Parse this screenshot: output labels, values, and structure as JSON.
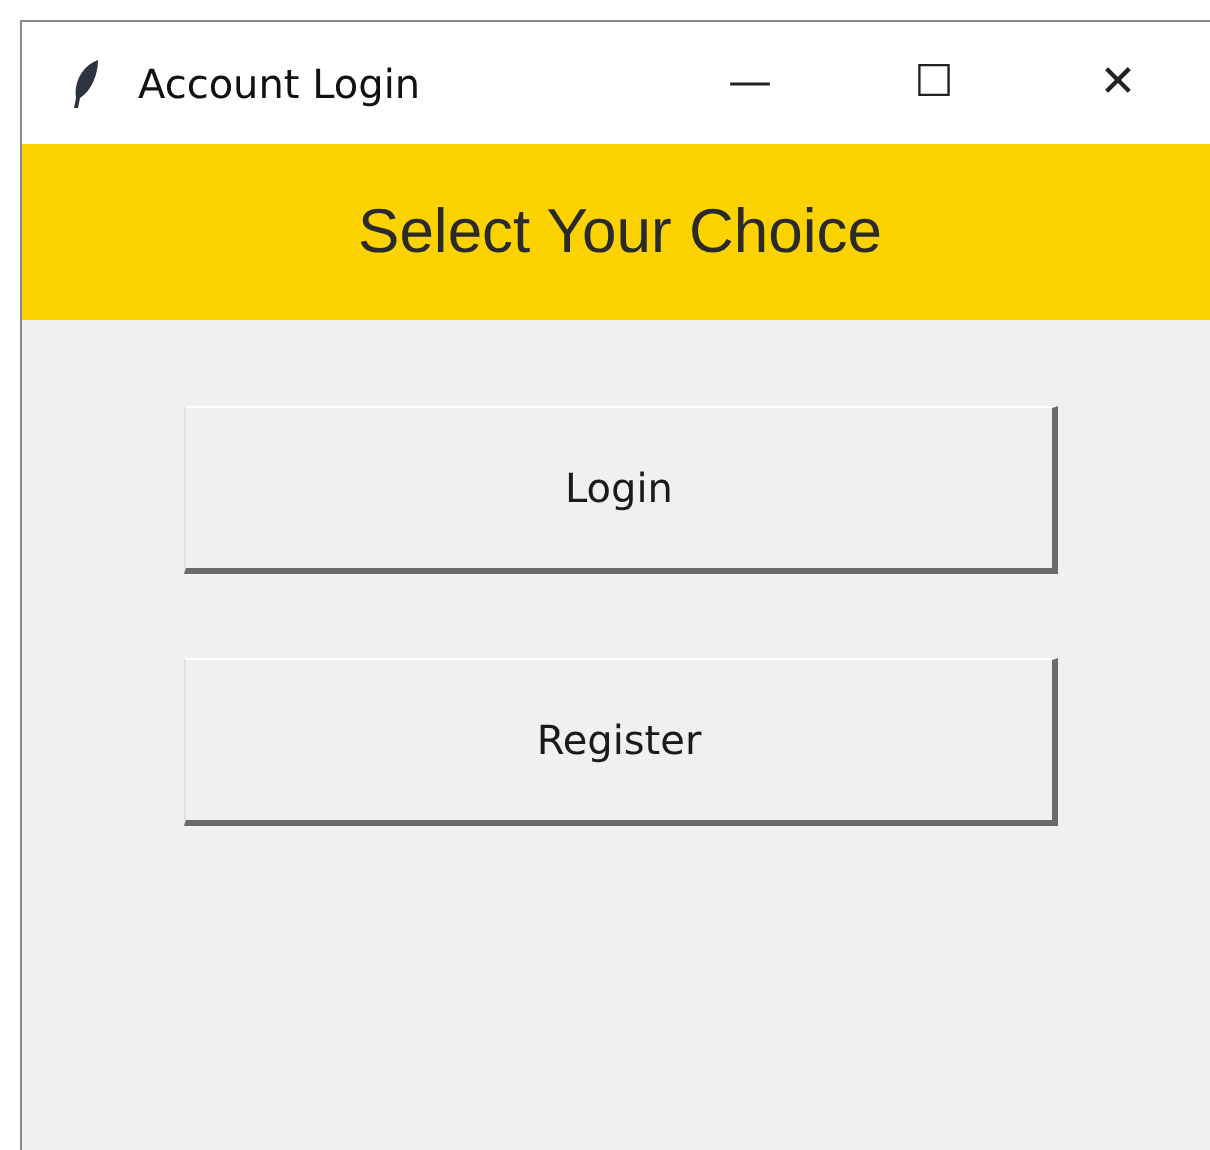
{
  "window": {
    "title": "Account Login",
    "controls": [
      "—",
      "☐",
      "✕"
    ]
  },
  "banner": {
    "text": "Select Your Choice"
  },
  "buttons": [
    {
      "label": "Login"
    },
    {
      "label": "Register"
    }
  ]
}
